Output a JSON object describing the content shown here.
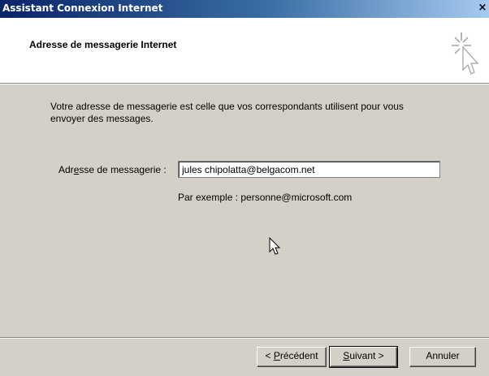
{
  "window": {
    "title": "Assistant Connexion Internet",
    "close_glyph": "×"
  },
  "header": {
    "title": "Adresse de messagerie Internet",
    "icon": "wizard-cursor-icon"
  },
  "body": {
    "intro": "Votre adresse de messagerie est celle que vos correspondants utilisent pour vous envoyer des messages.",
    "field_label_before": "Adr",
    "field_label_mnemonic": "e",
    "field_label_after": "sse de messagerie :",
    "email_value": "jules chipolatta@belgacom.net",
    "example": "Par exemple : personne@microsoft.com"
  },
  "buttons": {
    "prev_prefix": "< ",
    "prev_mnemonic": "P",
    "prev_rest": "récédent",
    "next_mnemonic": "S",
    "next_rest": "uivant >",
    "cancel": "Annuler"
  },
  "colors": {
    "titlebar_start": "#0a246a",
    "titlebar_end": "#a6caf0",
    "dialog_bg": "#d4d0c8",
    "header_bg": "#ffffff"
  }
}
